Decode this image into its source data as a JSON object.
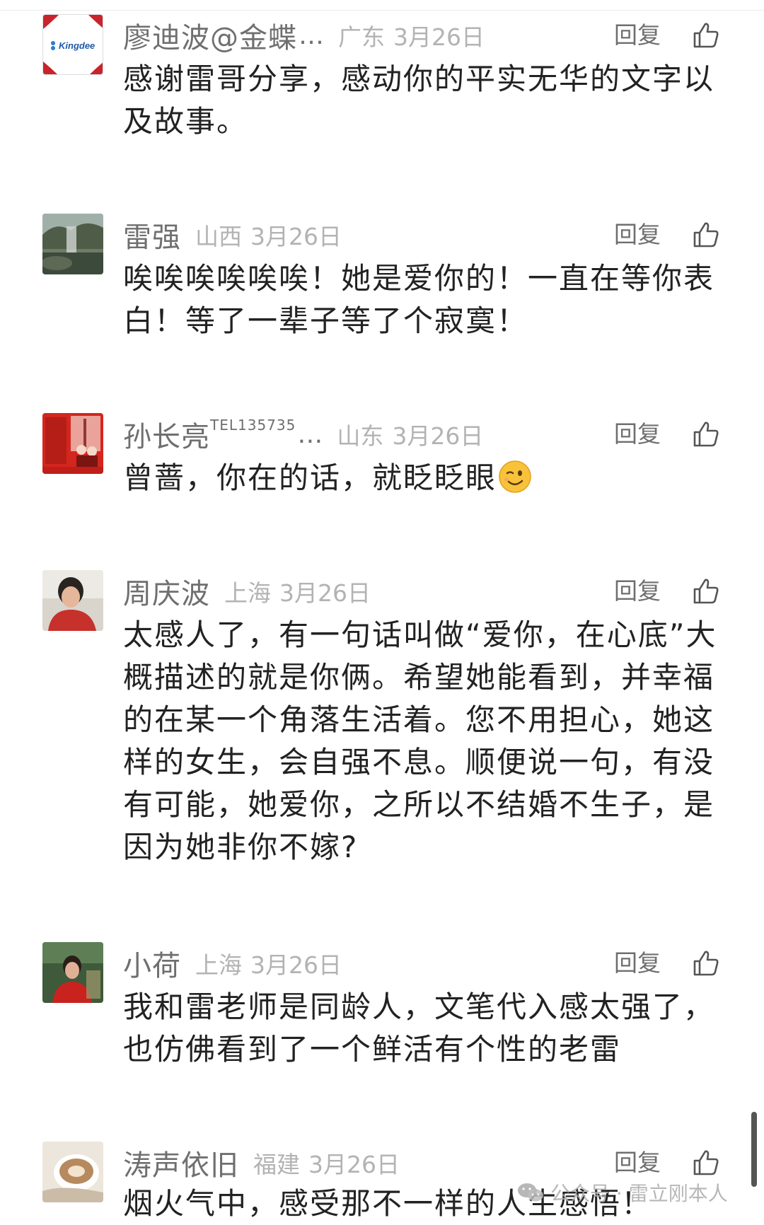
{
  "comments": [
    {
      "name": "廖迪波@金蝶",
      "name_truncated": "…",
      "location": "广东",
      "date": "3月26日",
      "reply_label": "回复",
      "text": "感谢雷哥分享，感动你的平实无华的文字以及故事。",
      "avatar_text": "Kingdee"
    },
    {
      "name": "雷强",
      "location": "山西",
      "date": "3月26日",
      "reply_label": "回复",
      "text": "唉唉唉唉唉唉！她是爱你的！一直在等你表白！等了一辈子等了个寂寞！"
    },
    {
      "name": "孙长亮",
      "name_sup": "TEL135735",
      "name_truncated": "…",
      "location": "山东",
      "date": "3月26日",
      "reply_label": "回复",
      "text": "曾蔷，你在的话，就眨眨眼",
      "emoji": "wink-emoji"
    },
    {
      "name": "周庆波",
      "location": "上海",
      "date": "3月26日",
      "reply_label": "回复",
      "text": "太感人了，有一句话叫做“爱你，在心底”大概描述的就是你俩。希望她能看到，并幸福的在某一个角落生活着。您不用担心，她这样的女生，会自强不息。顺便说一句，有没有可能，她爱你，之所以不结婚不生子，是因为她非你不嫁?"
    },
    {
      "name": "小荷",
      "location": "上海",
      "date": "3月26日",
      "reply_label": "回复",
      "text": "我和雷老师是同龄人，文笔代入感太强了，也仿佛看到了一个鲜活有个性的老雷"
    },
    {
      "name": "涛声依旧",
      "location": "福建",
      "date": "3月26日",
      "reply_label": "回复",
      "text": "烟火气中，感受那不一样的人生感悟！"
    }
  ],
  "watermark": {
    "text": "公众号 · 雷立刚本人",
    "icon": "wechat-icon"
  },
  "colors": {
    "name": "#6f6f6f",
    "meta": "#b3b3b3",
    "body": "#222222"
  }
}
